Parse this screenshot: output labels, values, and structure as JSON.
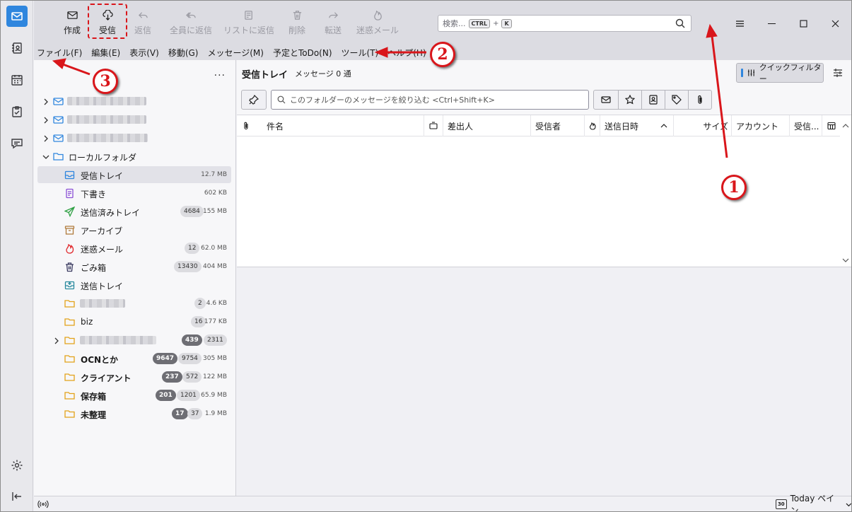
{
  "toolbar": {
    "compose": "作成",
    "get_messages": "受信",
    "reply": "返信",
    "reply_all": "全員に返信",
    "reply_list": "リストに返信",
    "delete": "削除",
    "forward": "転送",
    "junk": "迷惑メール"
  },
  "search": {
    "placeholder": "検索...",
    "key_ctrl": "CTRL",
    "plus": "+",
    "key_k": "K"
  },
  "menu": [
    "ファイル(F)",
    "編集(E)",
    "表示(V)",
    "移動(G)",
    "メッセージ(M)",
    "予定とToDo(N)",
    "ツール(T)",
    "ヘルプ(H)"
  ],
  "folder_pane": {
    "more": "...",
    "local_folders": "ローカルフォルダ",
    "folders": [
      {
        "name": "受信トレイ",
        "icon": "inbox-icon",
        "size": "12.7 MB",
        "unread": "",
        "total": ""
      },
      {
        "name": "下書き",
        "icon": "drafts-icon",
        "size": "602 KB",
        "unread": "",
        "total": ""
      },
      {
        "name": "送信済みトレイ",
        "icon": "sent-icon",
        "size": "155 MB",
        "unread": "",
        "total": "4684"
      },
      {
        "name": "アーカイブ",
        "icon": "archive-icon",
        "size": "",
        "unread": "",
        "total": ""
      },
      {
        "name": "迷惑メール",
        "icon": "junk-icon",
        "size": "62.0 MB",
        "unread": "",
        "total": "12"
      },
      {
        "name": "ごみ箱",
        "icon": "trash-icon",
        "size": "404 MB",
        "unread": "",
        "total": "13430"
      },
      {
        "name": "送信トレイ",
        "icon": "outbox-icon",
        "size": "",
        "unread": "",
        "total": ""
      },
      {
        "name": "",
        "icon": "folder-icon",
        "size": "4.6 KB",
        "unread": "",
        "total": "2"
      },
      {
        "name": "biz",
        "icon": "folder-icon",
        "size": "177 KB",
        "unread": "",
        "total": "16"
      },
      {
        "name": "",
        "icon": "folder-icon",
        "size": "",
        "unread": "439",
        "total": "2311"
      },
      {
        "name": "OCNとか",
        "icon": "folder-icon",
        "size": "305 MB",
        "unread": "9647",
        "total": "9754"
      },
      {
        "name": "クライアント",
        "icon": "folder-icon",
        "size": "122 MB",
        "unread": "237",
        "total": "572"
      },
      {
        "name": "保存箱",
        "icon": "folder-icon",
        "size": "65.9 MB",
        "unread": "201",
        "total": "1201"
      },
      {
        "name": "未整理",
        "icon": "folder-icon",
        "size": "1.9 MB",
        "unread": "17",
        "total": "37"
      }
    ]
  },
  "message_pane": {
    "folder_title": "受信トレイ",
    "message_count": "メッセージ 0 通",
    "quick_filter": "クイックフィルター",
    "filter_placeholder": "このフォルダーのメッセージを絞り込む <Ctrl+Shift+K>",
    "columns": {
      "subject": "件名",
      "sender": "差出人",
      "recipient": "受信者",
      "date": "送信日時",
      "size": "サイズ",
      "account": "アカウント",
      "received": "受信..."
    }
  },
  "status_bar": {
    "today_pane": "Today ペイン",
    "calendar_day": "30"
  },
  "annotations": {
    "callout_1": "1",
    "callout_2": "2",
    "callout_3": "3",
    "color": "#d9161b"
  }
}
